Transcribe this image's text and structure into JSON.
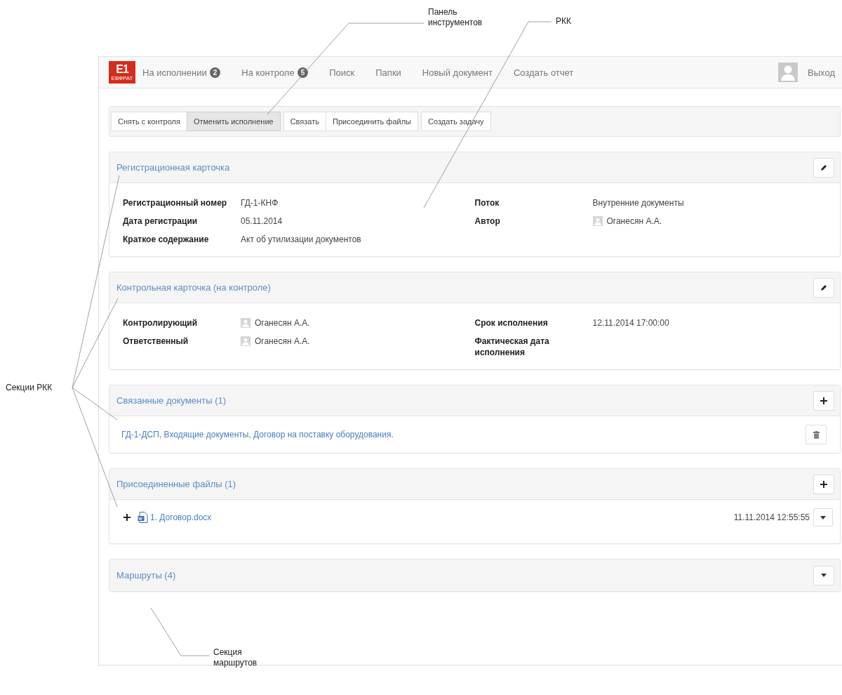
{
  "callouts": {
    "toolbar": "Панель инструментов",
    "card": "РКК",
    "sections": "Секции РКК",
    "routes": "Секция маршрутов"
  },
  "logo": {
    "mark": "E1",
    "caption": "ЕВФРАТ"
  },
  "nav": [
    {
      "label": "На исполнении",
      "badge": "2"
    },
    {
      "label": "На контроле",
      "badge": "5"
    },
    {
      "label": "Поиск"
    },
    {
      "label": "Папки"
    },
    {
      "label": "Новый документ"
    },
    {
      "label": "Создать отчет"
    }
  ],
  "logout": "Выход",
  "toolbar": [
    [
      {
        "label": "Снять с контроля",
        "active": false
      },
      {
        "label": "Отменить исполнение",
        "active": true
      }
    ],
    [
      {
        "label": "Связать",
        "active": false
      },
      {
        "label": "Присоединить файлы",
        "active": false
      }
    ],
    [
      {
        "label": "Создать задачу",
        "active": false
      }
    ]
  ],
  "sections": [
    {
      "kind": "fields",
      "title": "Регистрационная карточка",
      "button": {
        "kind": "edit"
      },
      "left": [
        {
          "label": "Регистрационный номер",
          "value": "ГД-1-КНФ",
          "person": false
        },
        {
          "label": "Дата регистрации",
          "value": "05.11.2014",
          "person": false
        },
        {
          "label": "Краткое содержание",
          "value": "Акт об утилизации документов",
          "person": false
        }
      ],
      "right": [
        {
          "label": "Поток",
          "value": "Внутренние документы",
          "person": false
        },
        {
          "label": "Автор",
          "value": "Оганесян А.А.",
          "person": true
        }
      ]
    },
    {
      "kind": "fields",
      "title": "Контрольная карточка (на контроле)",
      "button": {
        "kind": "edit"
      },
      "left": [
        {
          "label": "Контролирующий",
          "value": "Оганесян А.А.",
          "person": true
        },
        {
          "label": "Ответственный",
          "value": "Оганесян А.А.",
          "person": true
        }
      ],
      "right": [
        {
          "label": "Срок исполнения",
          "value": "12.11.2014 17:00:00",
          "person": false
        },
        {
          "label": "Фактическая дата исполнения",
          "person": false
        }
      ]
    },
    {
      "kind": "links",
      "title": "Связанные документы (1)",
      "button": {
        "kind": "add"
      },
      "links": [
        "ГД-1-ДСП, Входящие документы, Договор на поставку оборудования."
      ]
    },
    {
      "kind": "files",
      "title": "Присоединенные файлы (1)",
      "button": {
        "kind": "add"
      },
      "files": [
        {
          "name": "1. Договор.docx",
          "date": "11.11.2014 12:55:55"
        }
      ]
    },
    {
      "kind": "collapsed",
      "title": "Маршруты (4)",
      "button": {
        "kind": "expand"
      }
    }
  ]
}
